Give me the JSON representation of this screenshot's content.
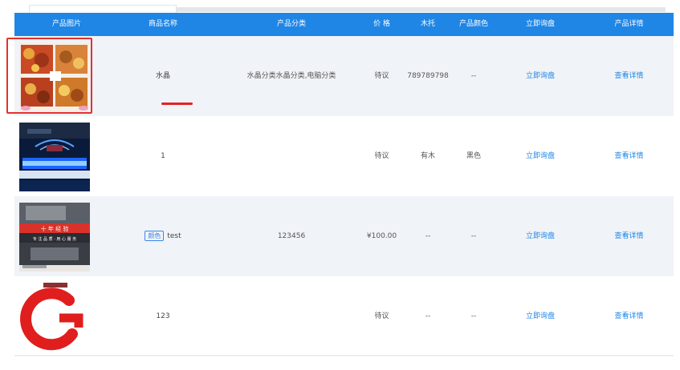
{
  "headers": [
    "产品图片",
    "商品名称",
    "产品分类",
    "价 格",
    "木托",
    "产品颜色",
    "立即询盘",
    "产品详情"
  ],
  "rows": [
    {
      "image_icon": "food-collage-image",
      "name": "水晶",
      "tag": "",
      "category": "水晶分类水晶分类,电脑分类",
      "price": "待议",
      "wood_pallet": "789789798",
      "color": "--",
      "inquiry": "立即询盘",
      "detail": "查看详情"
    },
    {
      "image_icon": "led-stage-image",
      "name": "1",
      "tag": "",
      "category": "",
      "price": "待议",
      "wood_pallet": "有木",
      "color": "黑色",
      "inquiry": "立即询盘",
      "detail": "查看详情"
    },
    {
      "image_icon": "laptop-banner-image",
      "name": "test",
      "tag": "颜色",
      "category": "123456",
      "price": "¥100.00",
      "wood_pallet": "--",
      "color": "--",
      "inquiry": "立即询盘",
      "detail": "查看详情"
    },
    {
      "image_icon": "red-c-logo-image",
      "name": "123",
      "tag": "",
      "category": "",
      "price": "待议",
      "wood_pallet": "--",
      "color": "--",
      "inquiry": "立即询盘",
      "detail": "查看详情"
    }
  ],
  "banner_text": {
    "line1": "十 年 经 验",
    "line2": "专 注 品 质 · 用 心 服 务"
  },
  "colors": {
    "header_bg": "#1f86e6",
    "link": "#1f86e6",
    "highlight": "#e23131",
    "row_alt": "#f0f3f7"
  }
}
